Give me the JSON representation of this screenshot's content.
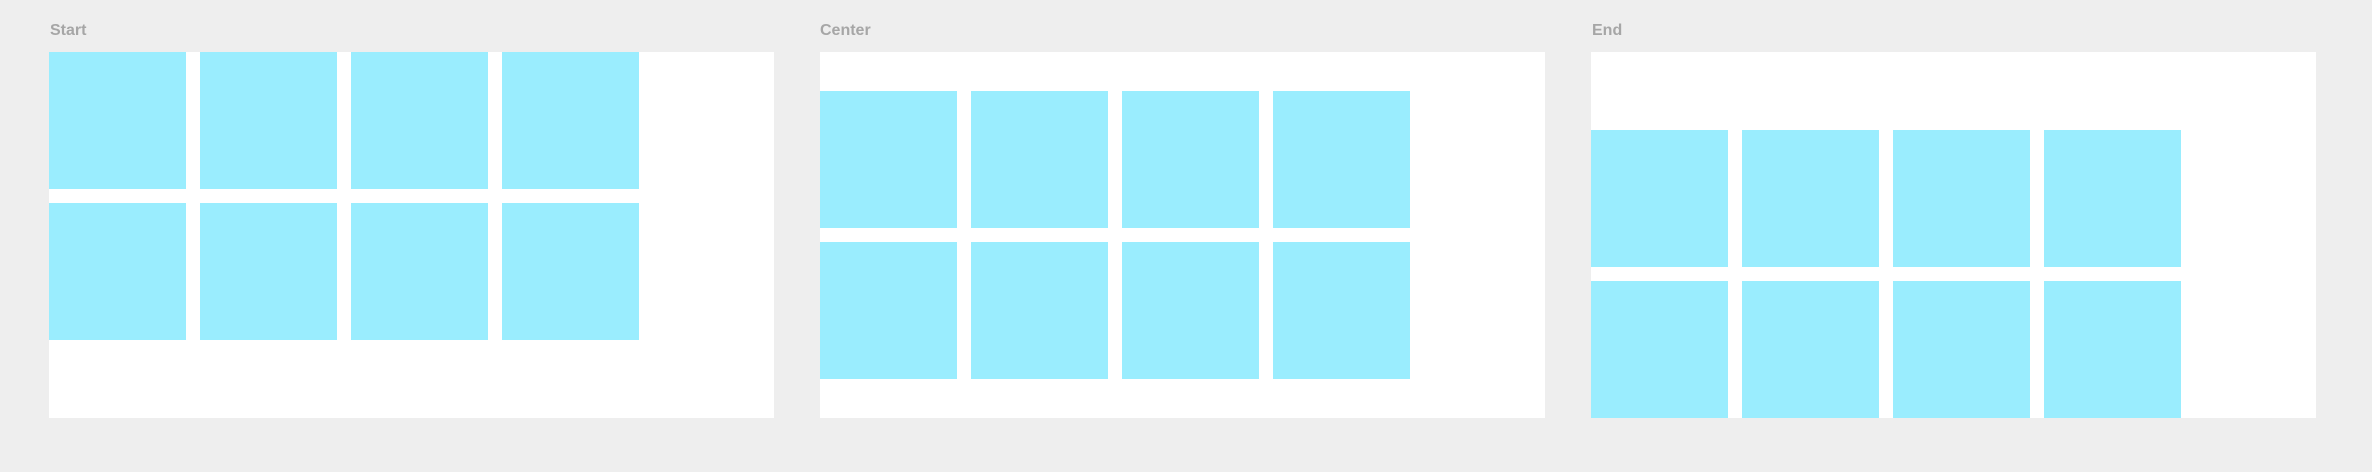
{
  "panels": [
    {
      "label": "Start",
      "align": "start",
      "rows": 2,
      "cols": 4
    },
    {
      "label": "Center",
      "align": "center",
      "rows": 2,
      "cols": 4
    },
    {
      "label": "End",
      "align": "end",
      "rows": 2,
      "cols": 4
    }
  ],
  "colors": {
    "background": "#eeeeee",
    "frame": "#ffffff",
    "cell": "#9aedfe",
    "label": "#a6a6a6"
  }
}
